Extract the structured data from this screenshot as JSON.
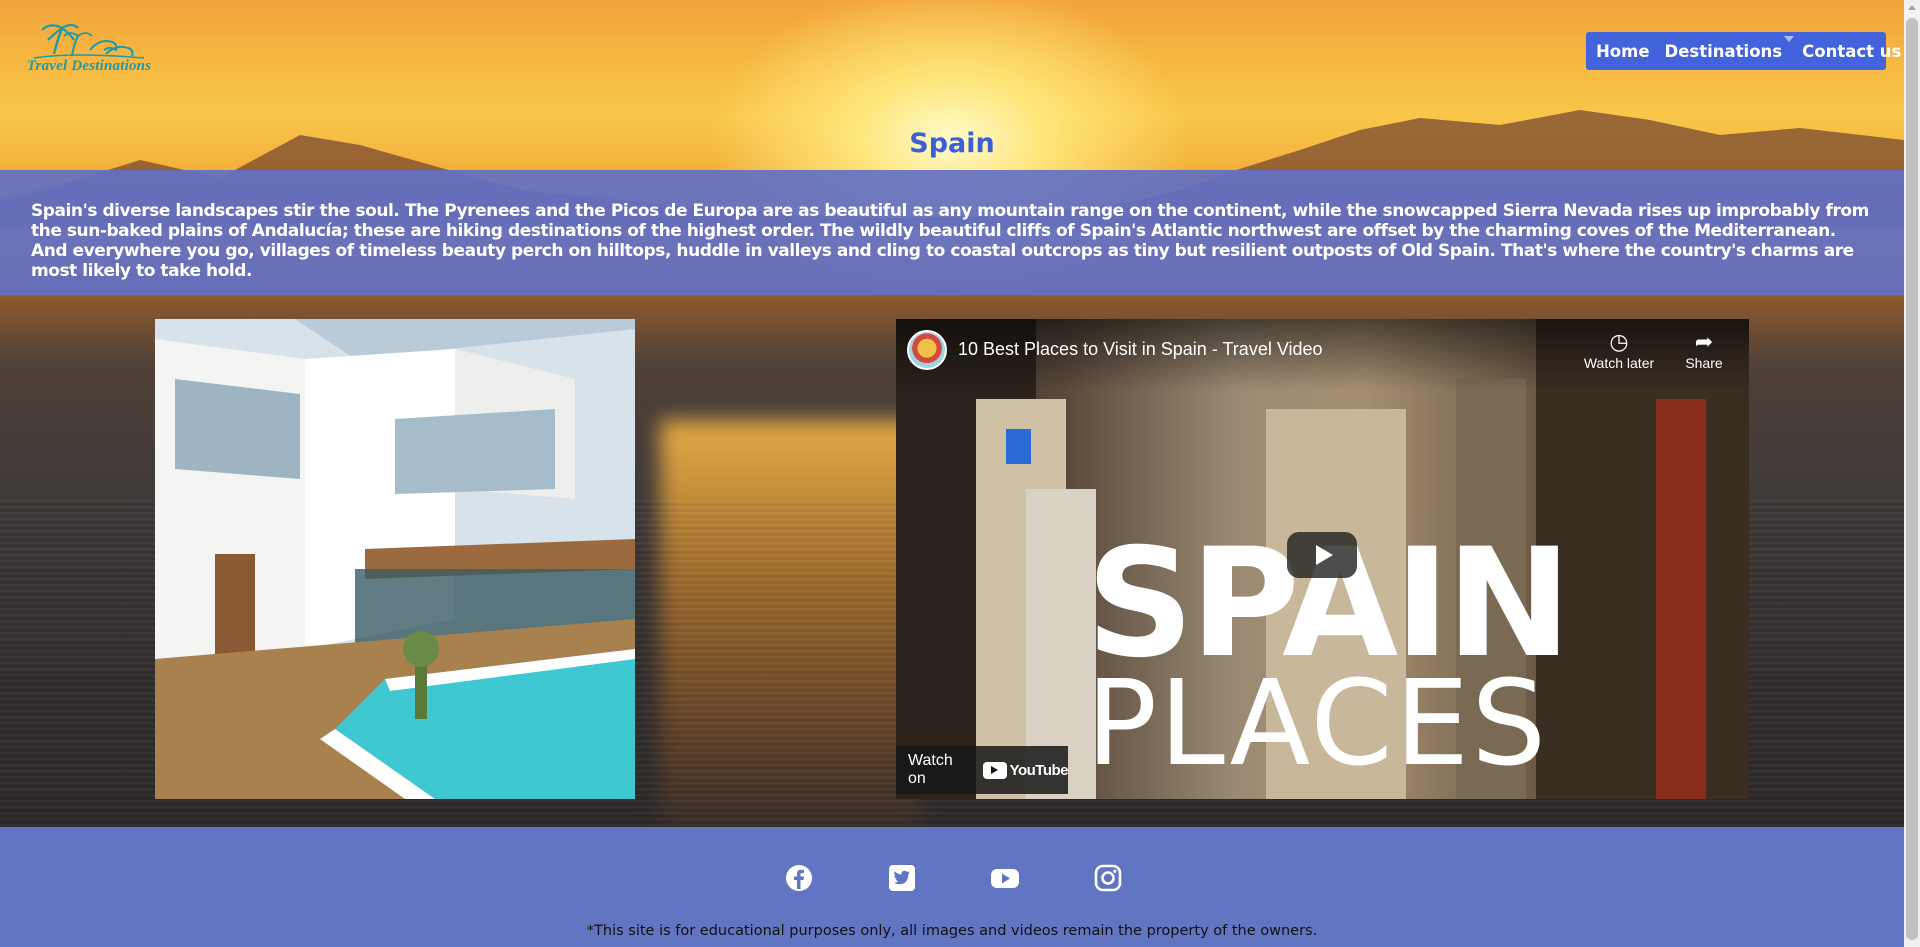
{
  "header": {
    "logo_text": "Travel Destinations",
    "nav": {
      "home": "Home",
      "destinations": "Destinations",
      "contact": "Contact us"
    }
  },
  "main": {
    "title": "Spain",
    "intro": "Spain's diverse landscapes stir the soul. The Pyrenees and the Picos de Europa are as beautiful as any mountain range on the continent, while the snowcapped Sierra Nevada rises up improbably from the sun-baked plains of Andalucía; these are hiking destinations of the highest order. The wildly beautiful cliffs of Spain's Atlantic northwest are offset by the charming coves of the Mediterranean. And everywhere you go, villages of timeless beauty perch on hilltops, huddle in valleys and cling to coastal outcrops as tiny but resilient outposts of Old Spain. That's where the country's charms are most likely to take hold."
  },
  "video": {
    "title": "10 Best Places to Visit in Spain - Travel Video",
    "watch_later": "Watch later",
    "share": "Share",
    "overlay_line1": "SPAIN",
    "overlay_line2": "PLACES",
    "watch_on": "Watch on",
    "youtube": "YouTube"
  },
  "footer": {
    "socials": [
      "facebook-icon",
      "twitter-icon",
      "youtube-icon",
      "instagram-icon"
    ],
    "note": "*This site is for educational purposes only, all images and videos remain the property of the owners."
  },
  "colors": {
    "nav_bg": "#4363dc",
    "title": "#3c5fd8",
    "band": "#6275c2"
  }
}
